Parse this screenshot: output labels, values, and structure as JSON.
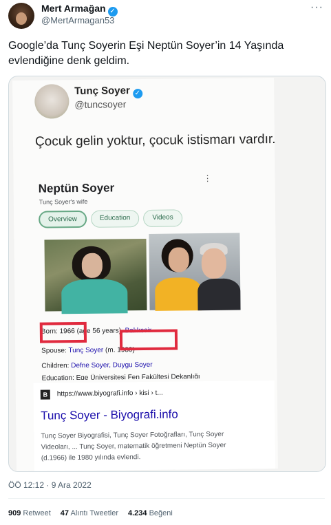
{
  "author": {
    "name": "Mert Armağan",
    "handle": "@MertArmagan53",
    "verified_icon": "✓",
    "more_icon": "···"
  },
  "tweet": {
    "text": "Google’da Tunç Soyerin Eşi Neptün Soyer’in 14 Yaşında evlendiğine denk geldim."
  },
  "embedded_tweet": {
    "name": "Tunç Soyer",
    "handle": "@tuncsoyer",
    "text": "Çocuk gelin yoktur, çocuk istismarı vardır."
  },
  "knowledge_panel": {
    "title": "Neptün Soyer",
    "subtitle": "Tunç Soyer's wife",
    "dots": "⋮",
    "chips": [
      "Overview",
      "Education",
      "Videos"
    ],
    "facts": {
      "born_label": "Born:",
      "born_value": "1966 (age 56 years),",
      "born_place": "Balıkesir",
      "spouse_label": "Spouse:",
      "spouse_value": "Tunç Soyer",
      "spouse_extra": "(m. 1980)",
      "children_label": "Children:",
      "children_value": "Defne Soyer, Duygu Soyer",
      "education_partial": "Education: Ege Üniversitesi Fen Fakültesi Dekanlığı"
    }
  },
  "search_result": {
    "favicon_letter": "B",
    "url": "https://www.biyografi.info › kisi › t...",
    "title": "Tunç Soyer - Biyografi.info",
    "snippet": "Tunç Soyer Biyografisi, Tunç Soyer Fotoğrafları, Tunç Soyer Videoları, ... Tunç Soyer, matematik öğretmeni Neptün Soyer (d.1966) ile 1980 yılında evlendi."
  },
  "meta": {
    "timestamp": "ÖÖ 12:12 · 9 Ara 2022"
  },
  "stats": {
    "retweets_count": "909",
    "retweets_label": "Retweet",
    "quotes_count": "47",
    "quotes_label": "Alıntı Tweetler",
    "likes_count": "4.234",
    "likes_label": "Beğeni"
  },
  "colors": {
    "link": "#1a0dab",
    "highlight_box": "#e02a3e",
    "verified": "#1d9bf0"
  }
}
